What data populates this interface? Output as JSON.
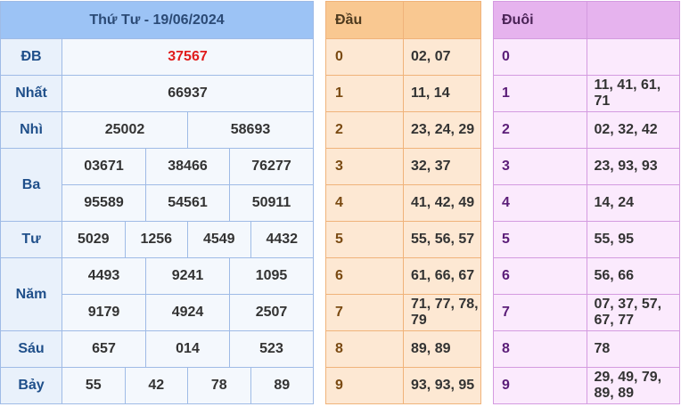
{
  "results": {
    "title": "Thứ Tư - 19/06/2024",
    "labels": {
      "db": "ĐB",
      "nhat": "Nhất",
      "nhi": "Nhì",
      "ba": "Ba",
      "tu": "Tư",
      "nam": "Năm",
      "sau": "Sáu",
      "bay": "Bảy"
    },
    "db": [
      "37567"
    ],
    "nhat": [
      "66937"
    ],
    "nhi": [
      "25002",
      "58693"
    ],
    "ba": [
      "03671",
      "38466",
      "76277",
      "95589",
      "54561",
      "50911"
    ],
    "tu": [
      "5029",
      "1256",
      "4549",
      "4432"
    ],
    "nam": [
      "4493",
      "9241",
      "1095",
      "9179",
      "4924",
      "2507"
    ],
    "sau": [
      "657",
      "014",
      "523"
    ],
    "bay": [
      "55",
      "42",
      "78",
      "89"
    ]
  },
  "head": {
    "title": "Đầu",
    "rows": [
      {
        "k": "0",
        "v": "02, 07"
      },
      {
        "k": "1",
        "v": "11, 14"
      },
      {
        "k": "2",
        "v": "23, 24, 29"
      },
      {
        "k": "3",
        "v": "32, 37"
      },
      {
        "k": "4",
        "v": "41, 42, 49"
      },
      {
        "k": "5",
        "v": "55, 56, 57"
      },
      {
        "k": "6",
        "v": "61, 66, 67"
      },
      {
        "k": "7",
        "v": "71, 77, 78, 79"
      },
      {
        "k": "8",
        "v": "89, 89"
      },
      {
        "k": "9",
        "v": "93, 93, 95"
      }
    ]
  },
  "tail": {
    "title": "Đuôi",
    "rows": [
      {
        "k": "0",
        "v": ""
      },
      {
        "k": "1",
        "v": "11, 41, 61, 71"
      },
      {
        "k": "2",
        "v": "02, 32, 42"
      },
      {
        "k": "3",
        "v": "23, 93, 93"
      },
      {
        "k": "4",
        "v": "14, 24"
      },
      {
        "k": "5",
        "v": "55, 95"
      },
      {
        "k": "6",
        "v": "56, 66"
      },
      {
        "k": "7",
        "v": "07, 37, 57, 67, 77"
      },
      {
        "k": "8",
        "v": "78"
      },
      {
        "k": "9",
        "v": "29, 49, 79, 89, 89"
      }
    ]
  }
}
